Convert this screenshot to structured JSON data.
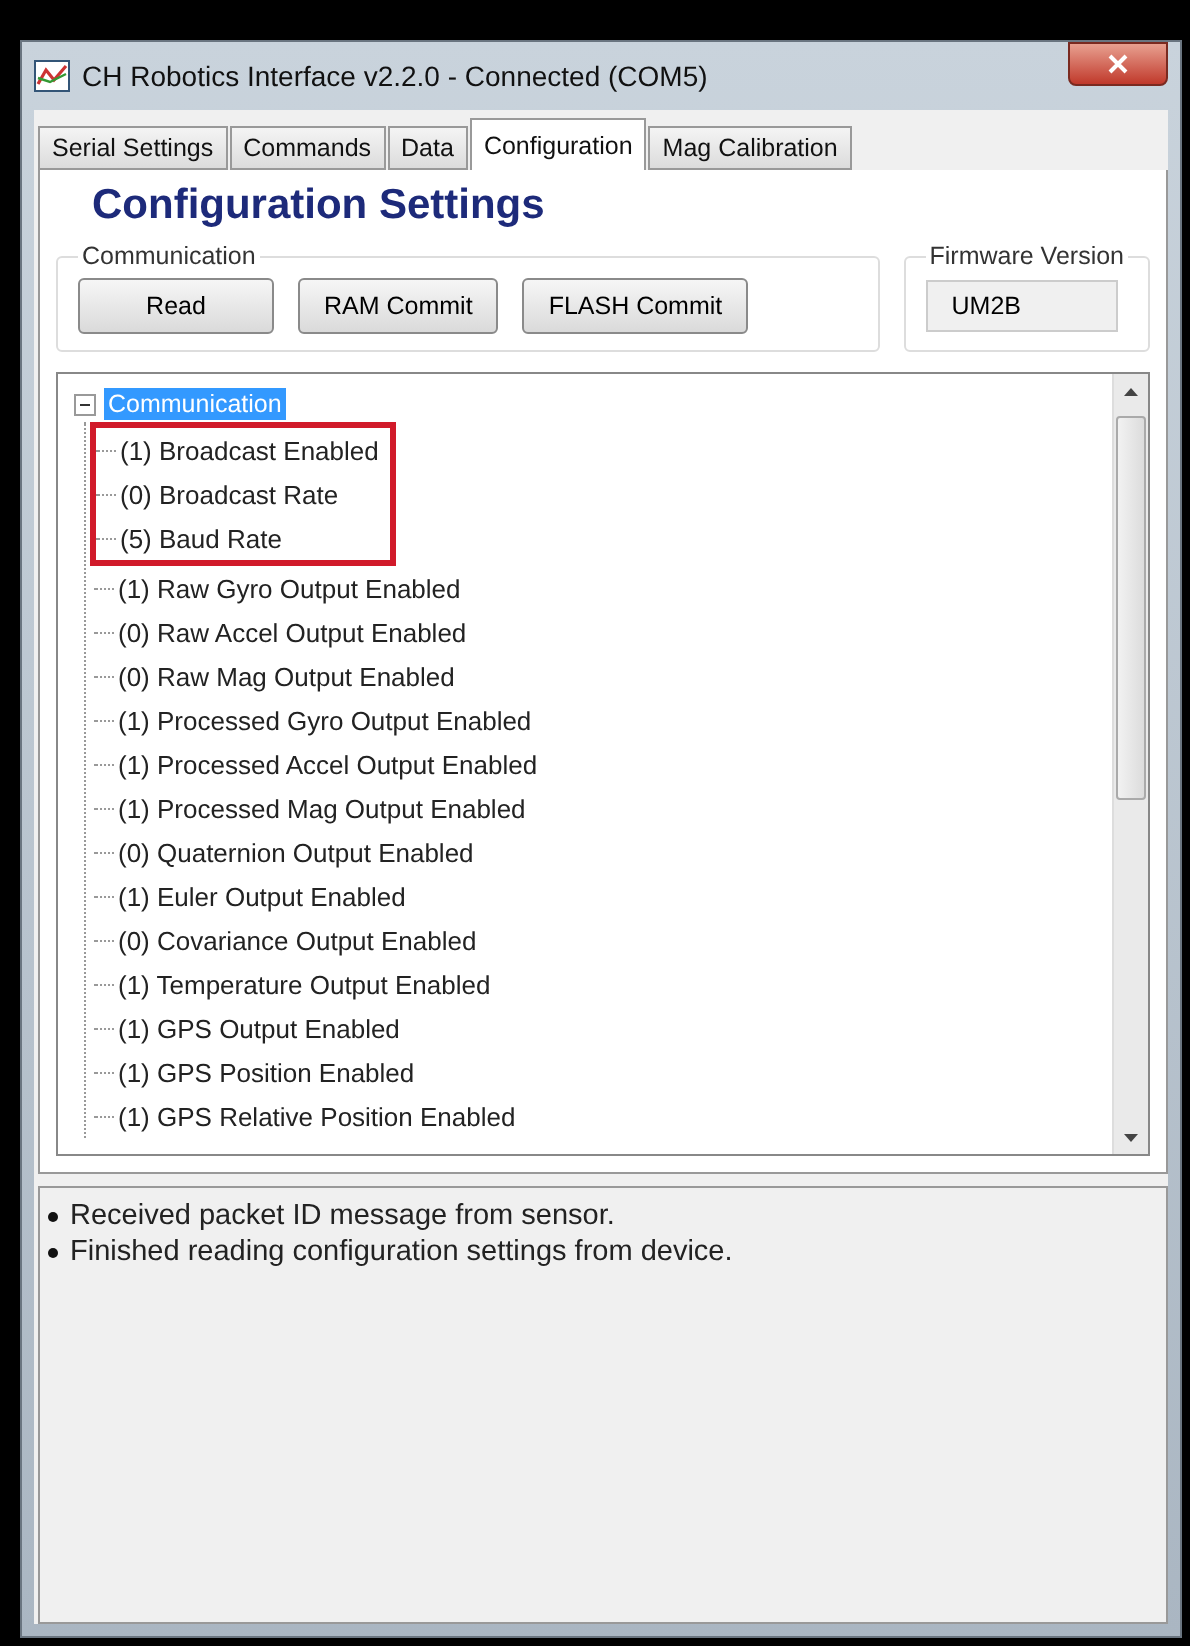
{
  "window": {
    "title": "CH Robotics Interface v2.2.0 - Connected (COM5)"
  },
  "tabs": [
    {
      "label": "Serial Settings",
      "selected": false
    },
    {
      "label": "Commands",
      "selected": false
    },
    {
      "label": "Data",
      "selected": false
    },
    {
      "label": "Configuration",
      "selected": true
    },
    {
      "label": "Mag Calibration",
      "selected": false
    }
  ],
  "heading": "Configuration Settings",
  "communication": {
    "legend": "Communication",
    "buttons": [
      "Read",
      "RAM Commit",
      "FLASH Commit"
    ]
  },
  "firmware": {
    "legend": "Firmware Version",
    "value": "UM2B"
  },
  "tree": {
    "label": "Communication",
    "expanded": true,
    "selected": true,
    "children": [
      {
        "label": "(1) Broadcast Enabled",
        "highlighted": true
      },
      {
        "label": "(0) Broadcast Rate",
        "highlighted": true
      },
      {
        "label": "(5) Baud Rate",
        "highlighted": true
      },
      {
        "label": "(1) Raw Gyro Output Enabled",
        "highlighted": false
      },
      {
        "label": "(0) Raw Accel Output Enabled",
        "highlighted": false
      },
      {
        "label": "(0) Raw Mag Output Enabled",
        "highlighted": false
      },
      {
        "label": "(1) Processed Gyro Output Enabled",
        "highlighted": false
      },
      {
        "label": "(1) Processed Accel Output Enabled",
        "highlighted": false
      },
      {
        "label": "(1) Processed Mag Output Enabled",
        "highlighted": false
      },
      {
        "label": "(0) Quaternion Output Enabled",
        "highlighted": false
      },
      {
        "label": "(1) Euler Output Enabled",
        "highlighted": false
      },
      {
        "label": "(0) Covariance Output Enabled",
        "highlighted": false
      },
      {
        "label": "(1) Temperature Output Enabled",
        "highlighted": false
      },
      {
        "label": "(1) GPS Output Enabled",
        "highlighted": false
      },
      {
        "label": "(1) GPS Position Enabled",
        "highlighted": false
      },
      {
        "label": "(1) GPS Relative Position Enabled",
        "highlighted": false
      }
    ]
  },
  "log": [
    "Received packet ID message from sensor.",
    "Finished reading configuration settings from device."
  ]
}
